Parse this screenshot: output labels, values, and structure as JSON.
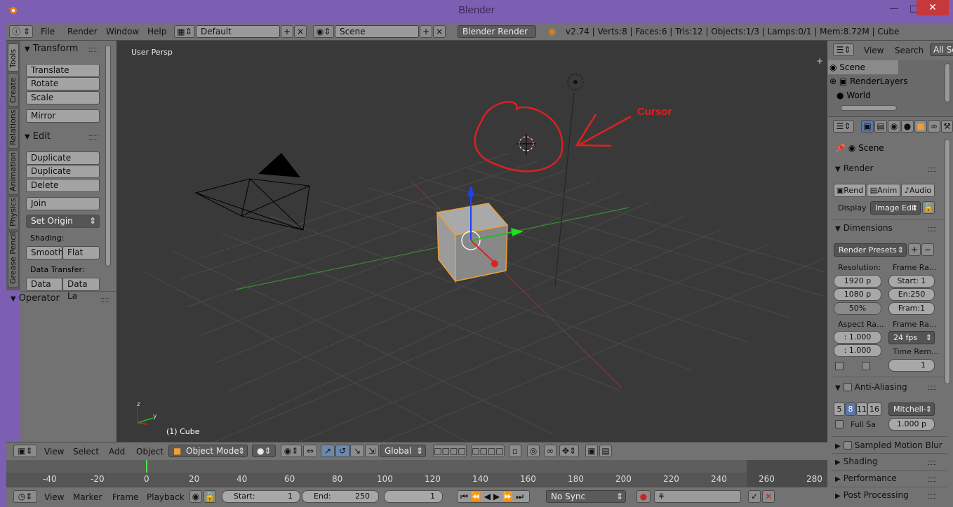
{
  "window": {
    "title": "Blender"
  },
  "info_header": {
    "menus": [
      "File",
      "Render",
      "Window",
      "Help"
    ],
    "layout": "Default",
    "scene": "Scene",
    "engine": "Blender Render",
    "stats": "v2.74 | Verts:8 | Faces:6 | Tris:12 | Objects:1/3 | Lamps:0/1 | Mem:8.72M | Cube"
  },
  "tool_tabs": [
    "Tools",
    "Create",
    "Relations",
    "Animation",
    "Physics",
    "Grease Pencil"
  ],
  "toolshelf": {
    "transform_title": "Transform",
    "transform_buttons": [
      "Translate",
      "Rotate",
      "Scale"
    ],
    "mirror": "Mirror",
    "edit_title": "Edit",
    "edit_buttons": [
      "Duplicate",
      "Duplicate Linked",
      "Delete"
    ],
    "join": "Join",
    "set_origin": "Set Origin",
    "shading_label": "Shading:",
    "smooth": "Smooth",
    "flat": "Flat",
    "data_transfer_label": "Data Transfer:",
    "data": "Data",
    "data_la": "Data La",
    "operator_title": "Operator"
  },
  "viewport": {
    "view_label": "User Persp",
    "object_label": "(1) Cube",
    "annotation": "Cursor",
    "annotation_color": "#e02020"
  },
  "view3d_header": {
    "menus": [
      "View",
      "Select",
      "Add",
      "Object"
    ],
    "mode": "Object Mode",
    "orientation": "Global"
  },
  "timeline": {
    "ticks": [
      "-40",
      "-20",
      "0",
      "20",
      "40",
      "60",
      "80",
      "100",
      "120",
      "140",
      "160",
      "180",
      "200",
      "220",
      "240",
      "260",
      "280"
    ],
    "current_frame_marker": 0
  },
  "timeline_header": {
    "menus": [
      "View",
      "Marker",
      "Frame",
      "Playback"
    ],
    "start_label": "Start:",
    "start_value": "1",
    "end_label": "End:",
    "end_value": "250",
    "current": "1",
    "sync": "No Sync"
  },
  "outliner": {
    "menus": [
      "View",
      "Search"
    ],
    "filter": "All Sc",
    "items": [
      "Scene",
      "RenderLayers",
      "World"
    ]
  },
  "properties": {
    "context": "Scene",
    "render": {
      "title": "Render",
      "buttons": [
        "Rend",
        "Anim",
        "Audio"
      ],
      "display_label": "Display",
      "display_value": "Image Edit"
    },
    "dimensions": {
      "title": "Dimensions",
      "presets": "Render Presets",
      "resolution_label": "Resolution:",
      "res_x": "1920 p",
      "res_y": "1080 p",
      "res_pct": "50%",
      "frame_range_label": "Frame Ra...",
      "start": "Start: 1",
      "end": "En:250",
      "frame": "Fram:1",
      "aspect_label": "Aspect Ra...",
      "aspect_x": ": 1.000",
      "aspect_y": ": 1.000",
      "frame_rate_label": "Frame Ra...",
      "fps": "24 fps",
      "time_remap_label": "Time Rem...",
      "time_remap_value": "1"
    },
    "anti_aliasing": {
      "title": "Anti-Aliasing",
      "samples": [
        "5",
        "8",
        "11",
        "16"
      ],
      "filter": "Mitchell-",
      "full_sample": "Full Sa",
      "size": "1.000 p"
    },
    "collapsed_panels": [
      "Sampled Motion Blur",
      "Shading",
      "Performance",
      "Post Processing"
    ]
  }
}
